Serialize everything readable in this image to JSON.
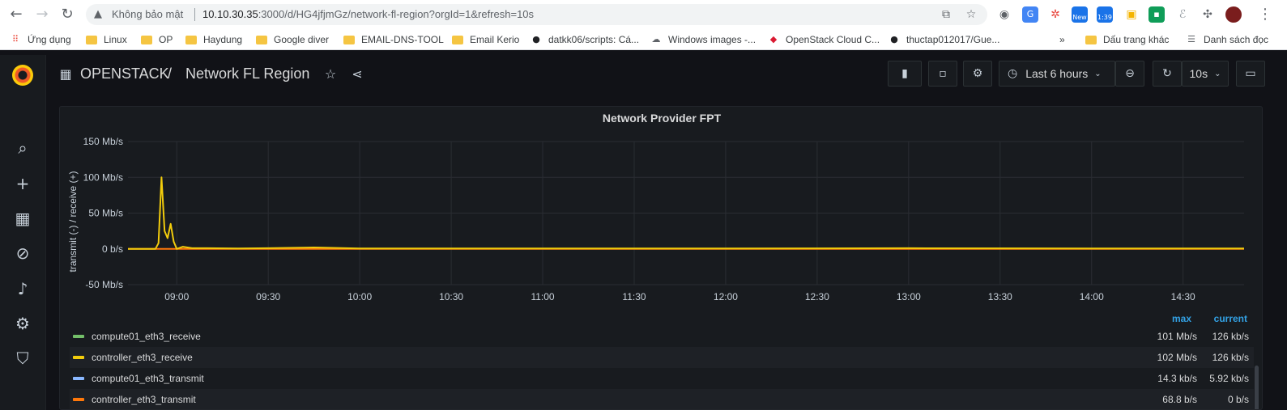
{
  "browser": {
    "insecure_label": "Không bảo mật",
    "url_host": "10.10.30.35",
    "url_rest": ":3000/d/HG4jfjmGz/network-fl-region?orgId=1&refresh=10s",
    "ext_new_label": "New",
    "ext_time_label": "1:39"
  },
  "bookmarks": [
    {
      "label": "Ứng dụng",
      "icon": "apps-grid-icon"
    },
    {
      "label": "Linux",
      "icon": "folder-icon"
    },
    {
      "label": "OP",
      "icon": "folder-icon"
    },
    {
      "label": "Haydung",
      "icon": "folder-icon"
    },
    {
      "label": "Google diver",
      "icon": "folder-icon"
    },
    {
      "label": "EMAIL-DNS-TOOL",
      "icon": "folder-icon"
    },
    {
      "label": "Email Kerio",
      "icon": "folder-icon"
    },
    {
      "label": "datkk06/scripts: Cá...",
      "icon": "github-icon"
    },
    {
      "label": "Windows images -...",
      "icon": "cloud-icon"
    },
    {
      "label": "OpenStack Cloud C...",
      "icon": "openstack-icon"
    },
    {
      "label": "thuctap012017/Gue...",
      "icon": "github-icon"
    }
  ],
  "bookmarks_right": {
    "more": "»",
    "other": "Dấu trang khác",
    "reading_list": "Danh sách đọc"
  },
  "grafana": {
    "folder": "OPENSTACK",
    "separator": "/",
    "dashboard_title": "Network FL Region",
    "time_range": "Last 6 hours",
    "refresh_interval": "10s"
  },
  "panel": {
    "title": "Network Provider FPT",
    "legend_headers": {
      "max": "max",
      "current": "current"
    },
    "legend": [
      {
        "name": "compute01_eth3_receive",
        "color": "#73bf69",
        "max": "101 Mb/s",
        "current": "126 kb/s"
      },
      {
        "name": "controller_eth3_receive",
        "color": "#f2cc0c",
        "max": "102 Mb/s",
        "current": "126 kb/s"
      },
      {
        "name": "compute01_eth3_transmit",
        "color": "#8ab8ff",
        "max": "14.3 kb/s",
        "current": "5.92 kb/s"
      },
      {
        "name": "controller_eth3_transmit",
        "color": "#ff780a",
        "max": "68.8 b/s",
        "current": "0 b/s"
      }
    ]
  },
  "chart_data": {
    "type": "line",
    "title": "Network Provider FPT",
    "ylabel": "transmit (-) / receive (+)",
    "y_ticks": [
      "150 Mb/s",
      "100 Mb/s",
      "50 Mb/s",
      "0 b/s",
      "-50 Mb/s"
    ],
    "ylim": [
      -50,
      150
    ],
    "y_unit": "Mb/s",
    "x_ticks": [
      "09:00",
      "09:30",
      "10:00",
      "10:30",
      "11:00",
      "11:30",
      "12:00",
      "12:30",
      "13:00",
      "13:30",
      "14:00",
      "14:30"
    ],
    "grid": true,
    "series": [
      {
        "name": "controller_eth3_receive",
        "color": "#f2cc0c",
        "x": [
          "08:44",
          "08:50",
          "08:53",
          "08:54",
          "08:55",
          "08:56",
          "08:57",
          "08:58",
          "08:59",
          "09:00",
          "09:02",
          "09:05",
          "09:10",
          "09:20",
          "09:30",
          "09:45",
          "10:00",
          "11:00",
          "12:00",
          "13:00",
          "14:00",
          "14:50"
        ],
        "values": [
          0,
          0,
          0,
          8,
          100,
          25,
          15,
          35,
          10,
          0,
          3,
          1,
          1,
          0.5,
          1,
          2,
          0.5,
          0.5,
          0.5,
          1,
          0.5,
          0.5
        ]
      },
      {
        "name": "controller_eth3_transmit",
        "color": "#ff780a",
        "x": [
          "08:44",
          "14:50"
        ],
        "values": [
          0,
          0
        ]
      }
    ]
  },
  "colors": {
    "accent": "#33a2e5",
    "background": "#111217",
    "panel": "#181b1f"
  }
}
